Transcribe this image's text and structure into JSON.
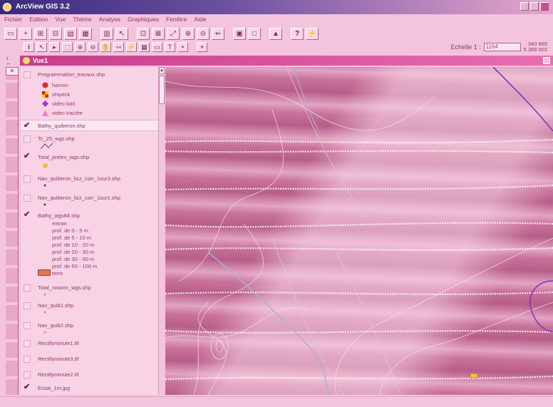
{
  "window": {
    "title": "ArcView GIS 3.2"
  },
  "menu": [
    "Fichier",
    "Edition",
    "Vue",
    "Thème",
    "Analyse",
    "Graphiques",
    "Fenêtre",
    "Aide"
  ],
  "scale": {
    "label": "Echelle 1 :",
    "value": "1164",
    "coord_x": "340 665",
    "coord_y": "5 389 002"
  },
  "view": {
    "title": "Vue1"
  },
  "toc": {
    "themes": [
      {
        "name": "Programmation_travaux.shp",
        "checked": false,
        "legend": [
          {
            "label": "hamon",
            "symbol": "red-circle"
          },
          {
            "label": "shipeck",
            "symbol": "checker-square"
          },
          {
            "label": "vidéo bati",
            "symbol": "purple-diamond"
          },
          {
            "label": "vidéo tractée",
            "symbol": "pink-triangle"
          }
        ]
      },
      {
        "name": "Bathy_quiberon.shp",
        "checked": true
      },
      {
        "name": "Tc_25_wgs.shp",
        "checked": false
      },
      {
        "name": "Total_prelev_wgs.shp",
        "checked": true
      },
      {
        "name": "Nav_quiberon_lizz_corr_1sur3.shp",
        "checked": false
      },
      {
        "name": "Nav_quiberon_lizz_corr_1sur1.shp",
        "checked": false
      },
      {
        "name": "Bathy_wgs84.shp",
        "checked": true,
        "legend": [
          "extran",
          "prof. de 0 - 5 m",
          "prof. de 5 - 10 m",
          "prof. de 10 - 20 m",
          "prof. de 20 - 30 m",
          "prof. de 30 - 50 m",
          "prof. de 50 - 100 m",
          "terre"
        ]
      },
      {
        "name": "Total_roxann_wgs.shp",
        "checked": false
      },
      {
        "name": "Nav_quib1.shp",
        "checked": false
      },
      {
        "name": "Nav_quib2.shp",
        "checked": false
      },
      {
        "name": "Rectifyminute1.tif",
        "checked": false
      },
      {
        "name": "Rectifyminute3.tif",
        "checked": false
      },
      {
        "name": "Rectifyminute2.tif",
        "checked": false
      },
      {
        "name": "Essai_1m.jpg",
        "checked": true
      }
    ]
  },
  "colors": {
    "accent": "#c83c8c",
    "panel": "#f8d3e6",
    "background": "#f4c4dc"
  }
}
